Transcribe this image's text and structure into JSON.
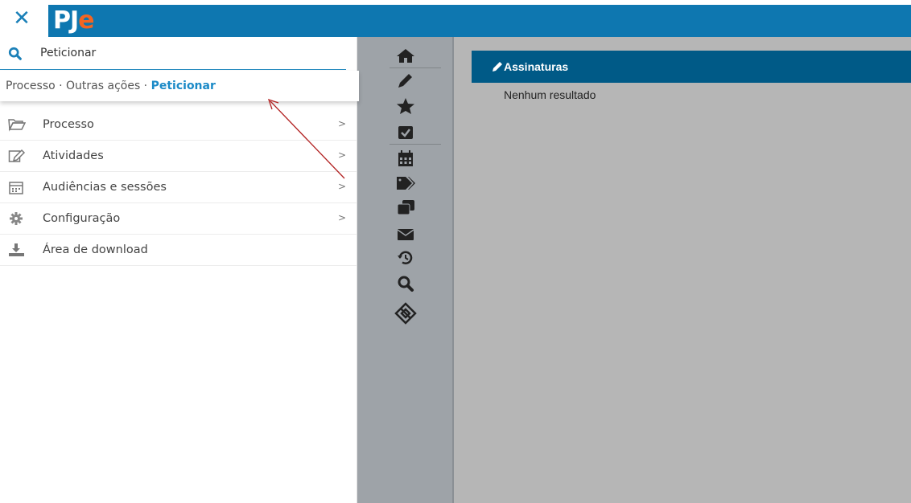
{
  "header": {
    "close_icon": "close-icon",
    "logo_main": "PJ",
    "logo_accent": "e",
    "brand_color": "#0e77b0",
    "logo_accent_color": "#f26522"
  },
  "search": {
    "value": "Peticionar",
    "icon": "search-icon",
    "suggestion": {
      "path": "Processo · Outras ações · ",
      "highlight": "Peticionar"
    }
  },
  "menu": {
    "items": [
      {
        "label": "Processo",
        "icon": "folder-open-icon",
        "arrow": ">"
      },
      {
        "label": "Atividades",
        "icon": "edit-icon",
        "arrow": ">"
      },
      {
        "label": "Audiências e sessões",
        "icon": "calendar-icon",
        "arrow": ">"
      },
      {
        "label": "Configuração",
        "icon": "gear-icon",
        "arrow": ">"
      },
      {
        "label": "Área de download",
        "icon": "download-icon",
        "arrow": ""
      }
    ]
  },
  "iconbar": {
    "icons": [
      "home-icon",
      "pencil-icon",
      "star-icon",
      "check-square-icon",
      "calendar-icon",
      "tags-icon",
      "clone-icon",
      "envelope-icon",
      "history-icon",
      "search-icon",
      "flow-icon"
    ]
  },
  "content": {
    "panel_title": "Assinaturas",
    "empty_text": "Nenhum resultado",
    "header_color": "#005a87"
  },
  "annotation": {
    "arrow_color": "#b22222"
  }
}
